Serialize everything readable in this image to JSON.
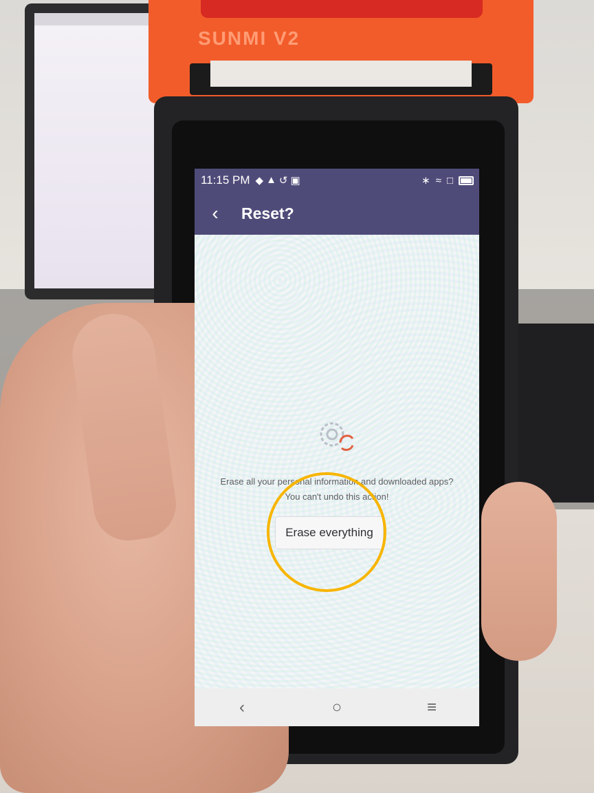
{
  "device": {
    "brand": "SUNMI V2"
  },
  "status_bar": {
    "time": "11:15 PM"
  },
  "app_bar": {
    "title": "Reset?"
  },
  "content": {
    "message_line1": "Erase all your personal information and downloaded apps?",
    "message_line2": "You can't undo this action!",
    "erase_button": "Erase everything"
  },
  "colors": {
    "app_bar": "#4f4b79",
    "highlight": "#f7b500",
    "device_orange": "#f25c2a"
  },
  "icons": {
    "back": "chevron-left-icon",
    "reset_graphic": "gear-reset-icon",
    "nav_back": "chevron-left-icon",
    "nav_home": "circle-home-icon",
    "nav_menu": "menu-icon"
  }
}
